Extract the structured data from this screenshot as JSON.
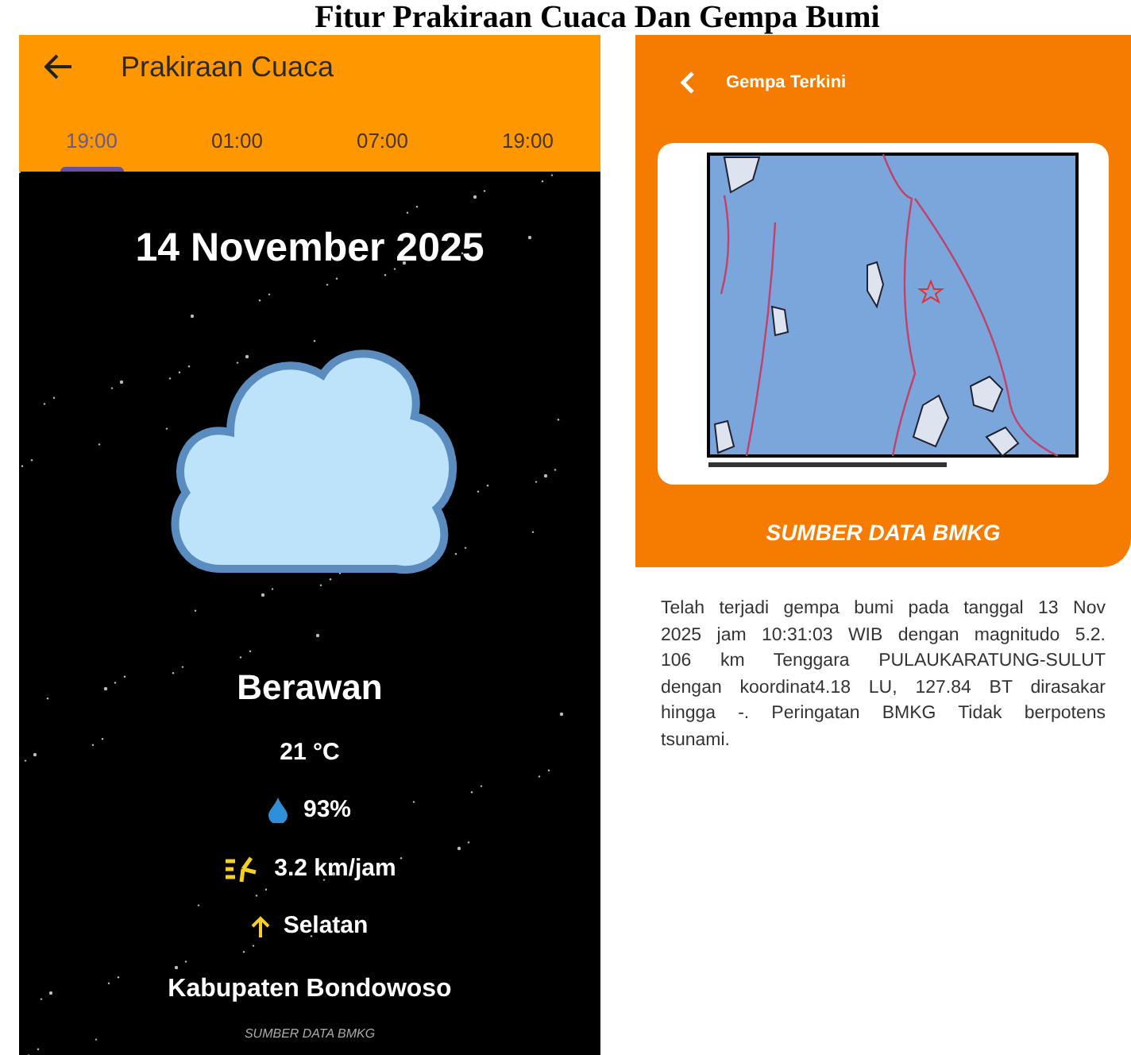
{
  "caption": "Fitur Prakiraan Cuaca Dan Gempa Bumi",
  "weather": {
    "title": "Prakiraan Cuaca",
    "tabs": [
      {
        "label": "19:00",
        "selected": true
      },
      {
        "label": "01:00",
        "selected": false
      },
      {
        "label": "07:00",
        "selected": false
      },
      {
        "label": "19:00",
        "selected": false
      }
    ],
    "date": "14 November 2025",
    "condition": "Berawan",
    "temperature": "21 °C",
    "humidity": "93%",
    "wind_speed": "3.2 km/jam",
    "wind_direction": "Selatan",
    "location": "Kabupaten Bondowoso",
    "source": "SUMBER DATA BMKG"
  },
  "earthquake": {
    "title": "Gempa Terkini",
    "source": "SUMBER DATA BMKG",
    "description_lines": [
      "Telah terjadi gempa bumi pada tanggal 13 Nov",
      "2025 jam 10:31:03 WIB dengan magnitudo 5.2.",
      "106 km Tenggara PULAUKARATUNG-SULUT",
      "dengan koordinat4.18 LU, 127.84 BT dirasakar",
      "hingga -. Peringatan BMKG Tidak berpotens",
      "tsunami."
    ]
  }
}
